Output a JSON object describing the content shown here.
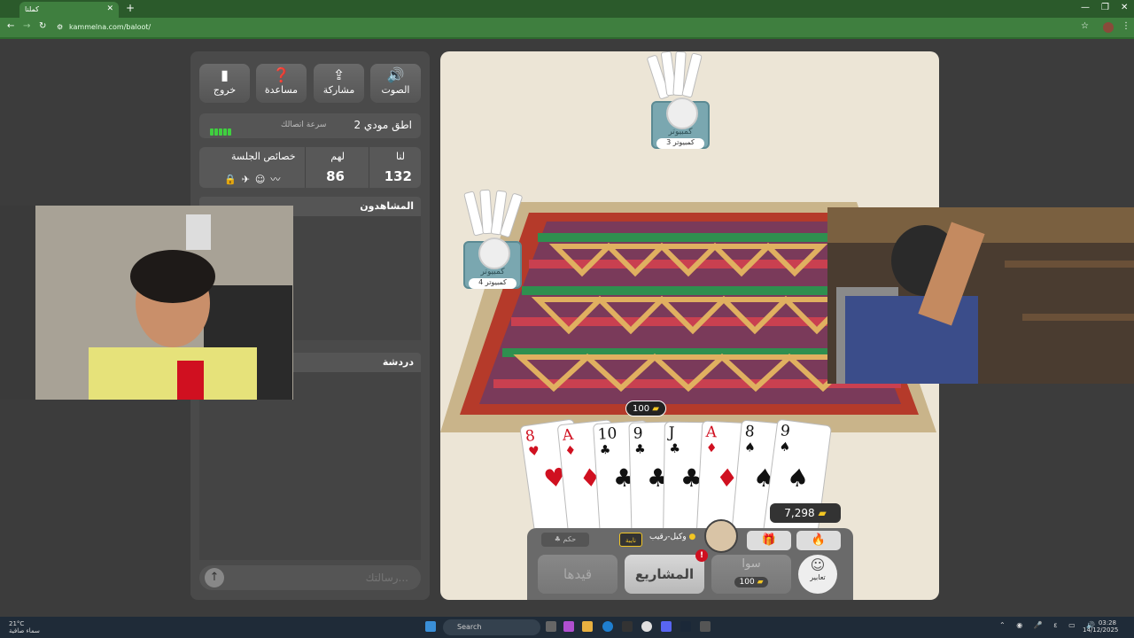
{
  "browser": {
    "tab_title": "كملنا",
    "url": "kammelna.com/baloot/",
    "new_tab": "+",
    "close_tab": "✕"
  },
  "toolbar": {
    "sound": "الصوت",
    "share": "مشاركة",
    "help": "مساعدة",
    "exit": "خروج"
  },
  "connection": {
    "room_name": "اطق مودي 2",
    "speed_label": "سرعة اتصالك",
    "signal_color": "#3fd03f"
  },
  "scores": {
    "us_label": "لنا",
    "them_label": "لهم",
    "session_label": "خصائص الجلسة",
    "us_value": "132",
    "them_value": "86"
  },
  "spectators": {
    "title": "المشاهدون"
  },
  "chat": {
    "title": "دردشة",
    "placeholder": "رسالتك..."
  },
  "players": {
    "top": {
      "name": "كمبيوتر",
      "tag": "كمبيوتر 3"
    },
    "left": {
      "name": "كمبيوتر",
      "tag": "كمبيوتر 4"
    }
  },
  "hand": [
    {
      "rank": "8",
      "suit": "♥",
      "color": "red"
    },
    {
      "rank": "A",
      "suit": "♦",
      "color": "red"
    },
    {
      "rank": "10",
      "suit": "♣",
      "color": "blk"
    },
    {
      "rank": "9",
      "suit": "♣",
      "color": "blk"
    },
    {
      "rank": "J",
      "suit": "♣",
      "color": "blk"
    },
    {
      "rank": "A",
      "suit": "♦",
      "color": "red"
    },
    {
      "rank": "8",
      "suit": "♠",
      "color": "blk"
    },
    {
      "rank": "9",
      "suit": "♠",
      "color": "blk"
    }
  ],
  "bid": {
    "value": "100"
  },
  "coins": {
    "value": "7,298"
  },
  "controls": {
    "hokm": "حكم",
    "nayba": "نايبة",
    "agent": "وكيل-رقيب",
    "projects": "المشاريع",
    "projects_badge": "!",
    "sawa": "سوا",
    "sawa_value": "100",
    "qaydha": "قيدها",
    "emotes": "تعابير"
  },
  "taskbar": {
    "weather_temp": "21°C",
    "weather_desc": "سماء صافية",
    "search": "Search",
    "time": "03:28",
    "date": "14/12/2025"
  },
  "colors": {
    "accent_green": "#3f7f3f",
    "panel": "#4a4a4a",
    "table": "#ece5d6",
    "gold": "#f3c623"
  }
}
